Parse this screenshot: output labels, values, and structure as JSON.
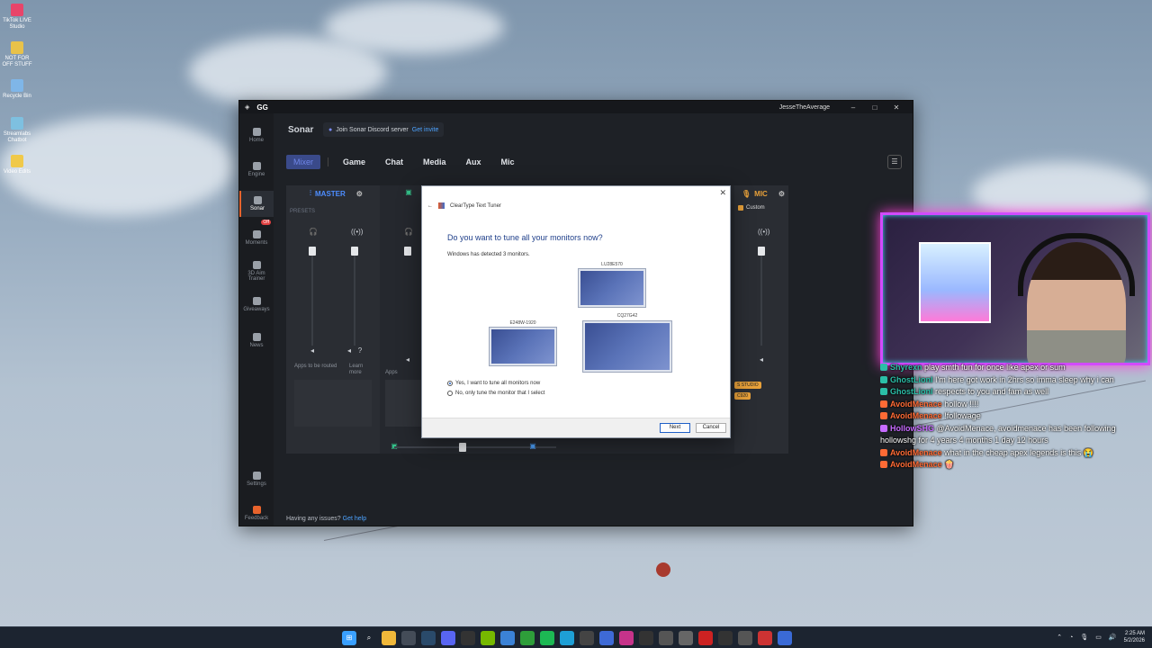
{
  "desktop": {
    "icons": [
      {
        "label": "TikTok LIVE Studio",
        "color": "#e8456a"
      },
      {
        "label": "NOT FOR OFF STUFF",
        "color": "#e8c24a"
      },
      {
        "label": "Recycle Bin",
        "color": "#7fb6e8"
      },
      {
        "label": "Streamlabs Chatbot",
        "color": "#7ec0e0"
      },
      {
        "label": "Video Edits",
        "color": "#f0c94a"
      }
    ]
  },
  "gg_window": {
    "brand": "GG",
    "user": "JesseTheAverage",
    "controls": [
      "–",
      "□",
      "✕"
    ],
    "sidebar": [
      {
        "label": "Home",
        "icon": "home-icon"
      },
      {
        "label": "Engine",
        "icon": "engine-icon"
      },
      {
        "label": "Sonar",
        "icon": "sonar-icon",
        "active": true
      },
      {
        "label": "Moments",
        "icon": "moments-icon",
        "badge": "Off"
      },
      {
        "label": "3D Aim Trainer",
        "icon": "aim-trainer-icon"
      },
      {
        "label": "Giveaways",
        "icon": "giveaways-icon"
      },
      {
        "label": "News",
        "icon": "news-icon"
      },
      {
        "label": "Settings",
        "icon": "settings-icon"
      },
      {
        "label": "Feedback",
        "icon": "feedback-icon"
      }
    ],
    "page_title": "Sonar",
    "discord": {
      "text": "Join Sonar Discord server",
      "link": "Get invite"
    },
    "tabs": [
      "Mixer",
      "Game",
      "Chat",
      "Media",
      "Aux",
      "Mic"
    ],
    "mixer": {
      "master_label": "MASTER",
      "presets_label": "PRESETS",
      "apps_routed": "Apps to be routed",
      "learn_more": "Learn more",
      "apps": "Apps",
      "mic_label": "MIC",
      "mic_preset": "Custom",
      "mic_tags": [
        "S STUDIO",
        "C920"
      ]
    },
    "issues": {
      "text": "Having any issues?",
      "link": "Get help"
    },
    "accent_colors": {
      "master": "#4d8dff",
      "mic": "#e8a13a",
      "game": "#34c28a"
    }
  },
  "dialog": {
    "title": "ClearType Text Tuner",
    "question": "Do you want to tune all your monitors now?",
    "detected": "Windows has detected 3 monitors.",
    "monitors": [
      {
        "label": "LU28E570"
      },
      {
        "label": "E248W-1920"
      },
      {
        "label": "CQ27G42"
      }
    ],
    "options": [
      {
        "text": "Yes, I want to tune all monitors now",
        "selected": true
      },
      {
        "text": "No, only tune the monitor that I select",
        "selected": false
      }
    ],
    "buttons": {
      "next": "Next",
      "cancel": "Cancel"
    },
    "close": "✕"
  },
  "chat": [
    {
      "name": "Shyrexn",
      "msg": "play smth fun for once like apex or sum",
      "color": "teal",
      "prefix": ""
    },
    {
      "name": "GhostLionI",
      "msg": "I'm here got work in 2hrs so imma sleep why i can",
      "color": "teal",
      "prefix": ""
    },
    {
      "name": "GhostLionI",
      "msg": "respects to you and fam as well",
      "color": "teal",
      "prefix": ""
    },
    {
      "name": "AvoidMenace",
      "msg": "hollow !!!!",
      "color": "orange",
      "prefix": ""
    },
    {
      "name": "AvoidMenace",
      "msg": "!followage",
      "color": "orange",
      "prefix": ""
    },
    {
      "name": "HollowSHG",
      "msg": "@AvoidMenace, avoidmenace has been following hollowshg for 4 years 4 months 1 day 12 hours",
      "color": "purple",
      "prefix": ""
    },
    {
      "name": "AvoidMenace",
      "msg": "what in the cheap apex legends is this 😭",
      "color": "orange",
      "prefix": ""
    },
    {
      "name": "AvoidMenace",
      "msg": "🍿",
      "color": "orange",
      "prefix": ""
    }
  ],
  "taskbar": {
    "time": "2:25 AM",
    "date": "5/2/2026",
    "apps": [
      {
        "icon": "windows-start-icon",
        "color": "#3aa0ff",
        "glyph": "⊞"
      },
      {
        "icon": "search-icon",
        "color": "#1c2430",
        "glyph": "⌕"
      },
      {
        "icon": "file-explorer-icon",
        "color": "#f0b83a",
        "glyph": ""
      },
      {
        "icon": "terminal-icon",
        "color": "#444c58",
        "glyph": ""
      },
      {
        "icon": "steam-icon",
        "color": "#2a4a6a",
        "glyph": ""
      },
      {
        "icon": "discord-icon",
        "color": "#5865f2",
        "glyph": ""
      },
      {
        "icon": "epic-icon",
        "color": "#333",
        "glyph": ""
      },
      {
        "icon": "nvidia-icon",
        "color": "#76b900",
        "glyph": ""
      },
      {
        "icon": "browser-icon",
        "color": "#3b82d6",
        "glyph": ""
      },
      {
        "icon": "xbox-icon",
        "color": "#2e9e3a",
        "glyph": ""
      },
      {
        "icon": "spotify-icon",
        "color": "#1db954",
        "glyph": ""
      },
      {
        "icon": "edge-icon",
        "color": "#1e9fd6",
        "glyph": ""
      },
      {
        "icon": "ubisoft-icon",
        "color": "#444",
        "glyph": ""
      },
      {
        "icon": "rocket-icon",
        "color": "#3e6ad6",
        "glyph": ""
      },
      {
        "icon": "valorant-icon",
        "color": "#c6338a",
        "glyph": ""
      },
      {
        "icon": "obs-icon",
        "color": "#333",
        "glyph": ""
      },
      {
        "icon": "app-icon",
        "color": "#555",
        "glyph": ""
      },
      {
        "icon": "app2-icon",
        "color": "#666",
        "glyph": ""
      },
      {
        "icon": "app3-icon",
        "color": "#c22",
        "glyph": ""
      },
      {
        "icon": "app4-icon",
        "color": "#333",
        "glyph": ""
      },
      {
        "icon": "app5-icon",
        "color": "#555",
        "glyph": ""
      },
      {
        "icon": "app6-icon",
        "color": "#c33",
        "glyph": ""
      },
      {
        "icon": "app7-icon",
        "color": "#3a6ad6",
        "glyph": ""
      }
    ]
  }
}
